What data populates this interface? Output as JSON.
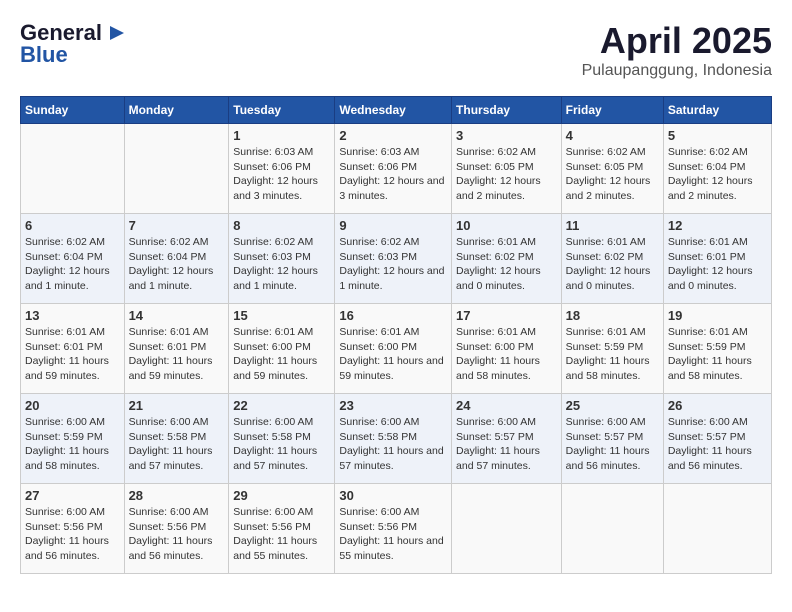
{
  "header": {
    "logo_line1": "General",
    "logo_line2": "Blue",
    "title": "April 2025",
    "subtitle": "Pulaupanggung, Indonesia"
  },
  "weekdays": [
    "Sunday",
    "Monday",
    "Tuesday",
    "Wednesday",
    "Thursday",
    "Friday",
    "Saturday"
  ],
  "weeks": [
    [
      {
        "day": "",
        "content": ""
      },
      {
        "day": "",
        "content": ""
      },
      {
        "day": "1",
        "content": "Sunrise: 6:03 AM\nSunset: 6:06 PM\nDaylight: 12 hours and 3 minutes."
      },
      {
        "day": "2",
        "content": "Sunrise: 6:03 AM\nSunset: 6:06 PM\nDaylight: 12 hours and 3 minutes."
      },
      {
        "day": "3",
        "content": "Sunrise: 6:02 AM\nSunset: 6:05 PM\nDaylight: 12 hours and 2 minutes."
      },
      {
        "day": "4",
        "content": "Sunrise: 6:02 AM\nSunset: 6:05 PM\nDaylight: 12 hours and 2 minutes."
      },
      {
        "day": "5",
        "content": "Sunrise: 6:02 AM\nSunset: 6:04 PM\nDaylight: 12 hours and 2 minutes."
      }
    ],
    [
      {
        "day": "6",
        "content": "Sunrise: 6:02 AM\nSunset: 6:04 PM\nDaylight: 12 hours and 1 minute."
      },
      {
        "day": "7",
        "content": "Sunrise: 6:02 AM\nSunset: 6:04 PM\nDaylight: 12 hours and 1 minute."
      },
      {
        "day": "8",
        "content": "Sunrise: 6:02 AM\nSunset: 6:03 PM\nDaylight: 12 hours and 1 minute."
      },
      {
        "day": "9",
        "content": "Sunrise: 6:02 AM\nSunset: 6:03 PM\nDaylight: 12 hours and 1 minute."
      },
      {
        "day": "10",
        "content": "Sunrise: 6:01 AM\nSunset: 6:02 PM\nDaylight: 12 hours and 0 minutes."
      },
      {
        "day": "11",
        "content": "Sunrise: 6:01 AM\nSunset: 6:02 PM\nDaylight: 12 hours and 0 minutes."
      },
      {
        "day": "12",
        "content": "Sunrise: 6:01 AM\nSunset: 6:01 PM\nDaylight: 12 hours and 0 minutes."
      }
    ],
    [
      {
        "day": "13",
        "content": "Sunrise: 6:01 AM\nSunset: 6:01 PM\nDaylight: 11 hours and 59 minutes."
      },
      {
        "day": "14",
        "content": "Sunrise: 6:01 AM\nSunset: 6:01 PM\nDaylight: 11 hours and 59 minutes."
      },
      {
        "day": "15",
        "content": "Sunrise: 6:01 AM\nSunset: 6:00 PM\nDaylight: 11 hours and 59 minutes."
      },
      {
        "day": "16",
        "content": "Sunrise: 6:01 AM\nSunset: 6:00 PM\nDaylight: 11 hours and 59 minutes."
      },
      {
        "day": "17",
        "content": "Sunrise: 6:01 AM\nSunset: 6:00 PM\nDaylight: 11 hours and 58 minutes."
      },
      {
        "day": "18",
        "content": "Sunrise: 6:01 AM\nSunset: 5:59 PM\nDaylight: 11 hours and 58 minutes."
      },
      {
        "day": "19",
        "content": "Sunrise: 6:01 AM\nSunset: 5:59 PM\nDaylight: 11 hours and 58 minutes."
      }
    ],
    [
      {
        "day": "20",
        "content": "Sunrise: 6:00 AM\nSunset: 5:59 PM\nDaylight: 11 hours and 58 minutes."
      },
      {
        "day": "21",
        "content": "Sunrise: 6:00 AM\nSunset: 5:58 PM\nDaylight: 11 hours and 57 minutes."
      },
      {
        "day": "22",
        "content": "Sunrise: 6:00 AM\nSunset: 5:58 PM\nDaylight: 11 hours and 57 minutes."
      },
      {
        "day": "23",
        "content": "Sunrise: 6:00 AM\nSunset: 5:58 PM\nDaylight: 11 hours and 57 minutes."
      },
      {
        "day": "24",
        "content": "Sunrise: 6:00 AM\nSunset: 5:57 PM\nDaylight: 11 hours and 57 minutes."
      },
      {
        "day": "25",
        "content": "Sunrise: 6:00 AM\nSunset: 5:57 PM\nDaylight: 11 hours and 56 minutes."
      },
      {
        "day": "26",
        "content": "Sunrise: 6:00 AM\nSunset: 5:57 PM\nDaylight: 11 hours and 56 minutes."
      }
    ],
    [
      {
        "day": "27",
        "content": "Sunrise: 6:00 AM\nSunset: 5:56 PM\nDaylight: 11 hours and 56 minutes."
      },
      {
        "day": "28",
        "content": "Sunrise: 6:00 AM\nSunset: 5:56 PM\nDaylight: 11 hours and 56 minutes."
      },
      {
        "day": "29",
        "content": "Sunrise: 6:00 AM\nSunset: 5:56 PM\nDaylight: 11 hours and 55 minutes."
      },
      {
        "day": "30",
        "content": "Sunrise: 6:00 AM\nSunset: 5:56 PM\nDaylight: 11 hours and 55 minutes."
      },
      {
        "day": "",
        "content": ""
      },
      {
        "day": "",
        "content": ""
      },
      {
        "day": "",
        "content": ""
      }
    ]
  ]
}
